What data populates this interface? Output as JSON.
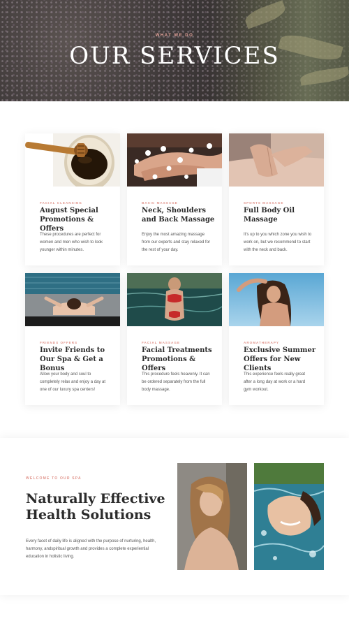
{
  "hero": {
    "eyebrow": "WHAT WE DO",
    "title": "OUR SERVICES"
  },
  "services": [
    {
      "tag": "FACIAL CLEANSING",
      "title": "August Special Promotions & Offers",
      "description": "These procedures are perfect for women and men who wish to look younger within minutes.",
      "image": "honey-pot-photo"
    },
    {
      "tag": "BASIC MASSAGE",
      "title": "Neck, Shoulders and Back Massage",
      "description": "Enjoy the most amazing massage from our experts and stay relaxed for the rest of your day.",
      "image": "hands-flowers-photo"
    },
    {
      "tag": "SPORTS MASSAGE",
      "title": "Full Body Oil Massage",
      "description": "It's up to you which zone you wish to work on, but we recommend to start with the neck and back.",
      "image": "back-massage-photo"
    },
    {
      "tag": "FRIENDS OFFERS",
      "title": "Invite Friends to Our Spa & Get a Bonus",
      "description": "Allow your body and soul to completely relax and enjoy a day at one of our luxury spa centers!",
      "image": "pool-lounger-photo"
    },
    {
      "tag": "FACIAL MASSAGE",
      "title": "Facial Treatments Promotions & Offers",
      "description": "This procedure feels heavenly. It can be ordered separately from the full body massage.",
      "image": "woman-pool-photo"
    },
    {
      "tag": "AROMATHERAPY",
      "title": "Exclusive Summer Offers for New Clients",
      "description": "This experience feels really great after a long day at work or a hard gym workout.",
      "image": "woman-sky-photo"
    }
  ],
  "about": {
    "tag": "WELCOME TO OUR SPA",
    "title": "Naturally Effective Health Solutions",
    "description": "Every facet of daily life is aligned with the purpose of nurturing, health, harmony, andspiritual growth and provides a complete experiential education in holistic living.",
    "images": [
      "woman-portrait-photo",
      "woman-water-photo"
    ]
  },
  "colors": {
    "accent": "#e0938a",
    "heading": "#2b2b2b",
    "body": "#555555",
    "background": "#ffffff"
  }
}
